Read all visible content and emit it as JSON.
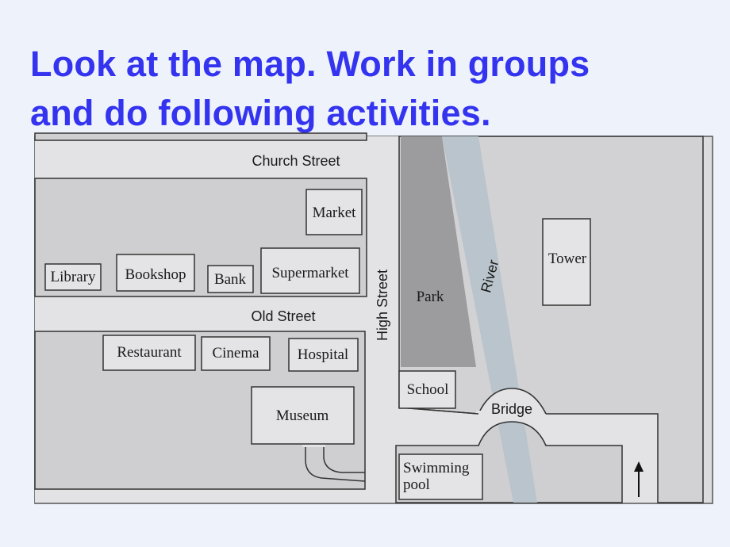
{
  "slide": {
    "title_line1": "Look at the map. Work in groups",
    "title_line2": "and do following activities."
  },
  "map": {
    "streets": {
      "church": "Church Street",
      "old": "Old Street",
      "high": "High Street"
    },
    "river": "River",
    "bridge": "Bridge",
    "buildings": {
      "market": "Market",
      "library": "Library",
      "bookshop": "Bookshop",
      "bank": "Bank",
      "supermarket": "Supermarket",
      "restaurant": "Restaurant",
      "cinema": "Cinema",
      "hospital": "Hospital",
      "museum": "Museum",
      "park": "Park",
      "tower": "Tower",
      "school": "School",
      "swimming_pool_line1": "Swimming",
      "swimming_pool_line2": "pool"
    },
    "north_arrow_icon": "arrow-up-icon",
    "colors": {
      "title": "#3434f0",
      "block": "#cfcfd2",
      "street": "#e6e6e8",
      "park": "#9c9c9e",
      "river": "#b9c4cc"
    }
  }
}
